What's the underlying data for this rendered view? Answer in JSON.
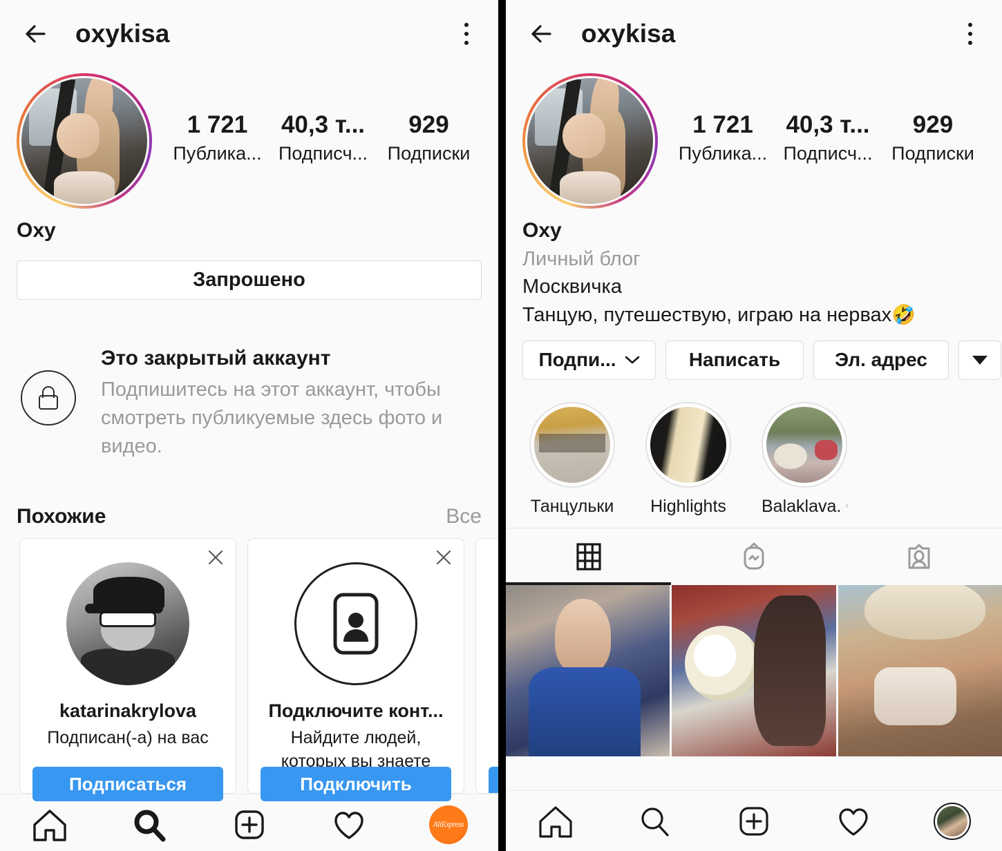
{
  "app": "instagram-profile",
  "colors": {
    "accent_blue": "#3897f0",
    "background": "#fafafa",
    "text": "#18191a",
    "muted": "#9a9a9a",
    "divider": "#e8e8e8",
    "ali_orange": "#ff7a18"
  },
  "left": {
    "topbar": {
      "back_icon": "back-arrow-icon",
      "title": "oxykisa",
      "menu_icon": "kebab-menu-icon"
    },
    "stats": [
      {
        "value": "1 721",
        "label": "Публика..."
      },
      {
        "value": "40,3 т...",
        "label": "Подписч..."
      },
      {
        "value": "929",
        "label": "Подписки"
      }
    ],
    "bio": {
      "name": "Oxy"
    },
    "primary_button": "Запрошено",
    "private": {
      "icon": "lock-icon",
      "title": "Это закрытый аккаунт",
      "text": "Подпишитесь на этот аккаунт, чтобы смотреть публикуемые здесь фото и видео."
    },
    "similar": {
      "title": "Похожие",
      "see_all": "Все",
      "cards": [
        {
          "name": "katarinakrylova",
          "subtitle": "Подписан(-а) на вас",
          "button": "Подписаться",
          "close_icon": "close-icon",
          "avatar": "user-photo"
        },
        {
          "name": "Подключите конт...",
          "subtitle": "Найдите людей, которых вы знаете",
          "button": "Подключить",
          "close_icon": "close-icon",
          "avatar": "contacts-card-icon"
        },
        {
          "name": "",
          "subtitle": "",
          "button": "",
          "close_icon": "close-icon",
          "avatar": ""
        }
      ]
    },
    "bottom_nav": [
      {
        "icon": "home-icon",
        "active": false
      },
      {
        "icon": "search-icon",
        "active": true
      },
      {
        "icon": "plus-square-icon",
        "active": false
      },
      {
        "icon": "heart-icon",
        "active": false
      },
      {
        "icon": "aliexpress-avatar-icon",
        "active": false,
        "label": "AliExpress"
      }
    ]
  },
  "right": {
    "topbar": {
      "back_icon": "back-arrow-icon",
      "title": "oxykisa",
      "menu_icon": "kebab-menu-icon"
    },
    "stats": [
      {
        "value": "1 721",
        "label": "Публика..."
      },
      {
        "value": "40,3 т...",
        "label": "Подписч..."
      },
      {
        "value": "929",
        "label": "Подписки"
      }
    ],
    "bio": {
      "name": "Oxy",
      "category": "Личный блог",
      "line1": "Москвичка",
      "line2": "Танцую, путешествую, играю на нервах",
      "emoji": "🤣"
    },
    "actions": [
      {
        "label": "Подпи...",
        "icon": "chevron-down-icon"
      },
      {
        "label": "Написать",
        "icon": null
      },
      {
        "label": "Эл. адрес",
        "icon": null
      },
      {
        "label": "",
        "icon": "triangle-down-icon"
      }
    ],
    "highlights": [
      {
        "label": "Танцульки",
        "cover": "dance-studio-cover"
      },
      {
        "label": "Highlights",
        "cover": "gold-dress-cover"
      },
      {
        "label": "Balaklava. Cr...",
        "cover": "balaklava-cover"
      }
    ],
    "tabs": [
      {
        "icon": "grid-icon",
        "active": true
      },
      {
        "icon": "igtv-icon",
        "active": false
      },
      {
        "icon": "tagged-icon",
        "active": false
      }
    ],
    "grid_posts": [
      {
        "alt": "mirror-selfie-blue-shirt"
      },
      {
        "alt": "daisies-bouquet-portrait"
      },
      {
        "alt": "beach-hat-portrait"
      }
    ],
    "bottom_nav": [
      {
        "icon": "home-icon",
        "active": false
      },
      {
        "icon": "search-icon",
        "active": false
      },
      {
        "icon": "plus-square-icon",
        "active": false
      },
      {
        "icon": "heart-icon",
        "active": false
      },
      {
        "icon": "profile-avatar-icon",
        "active": false
      }
    ]
  }
}
